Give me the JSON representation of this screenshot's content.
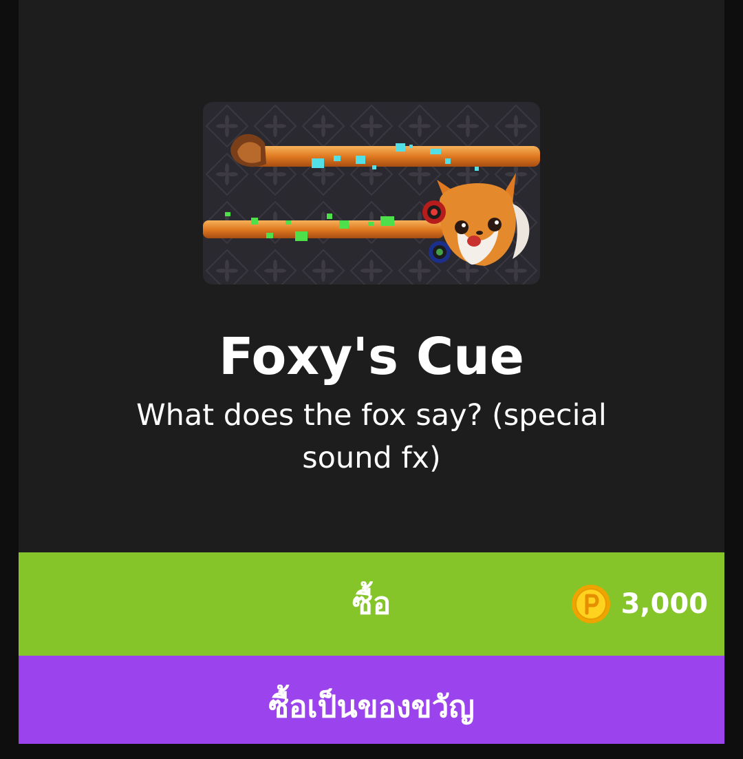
{
  "item": {
    "title": "Foxy's Cue",
    "description": "What does the fox say? (special sound fx)",
    "image_icon": "fox-cue-preview-image"
  },
  "buy": {
    "label": "ซื้อ",
    "price": "3,000",
    "currency_icon": "coin-icon"
  },
  "gift": {
    "label": "ซื้อเป็นของขวัญ"
  },
  "colors": {
    "panel": "#1d1d1d",
    "buy_green": "#85c52a",
    "gift_purple": "#9b43ec",
    "coin_gold": "#f5b800"
  }
}
